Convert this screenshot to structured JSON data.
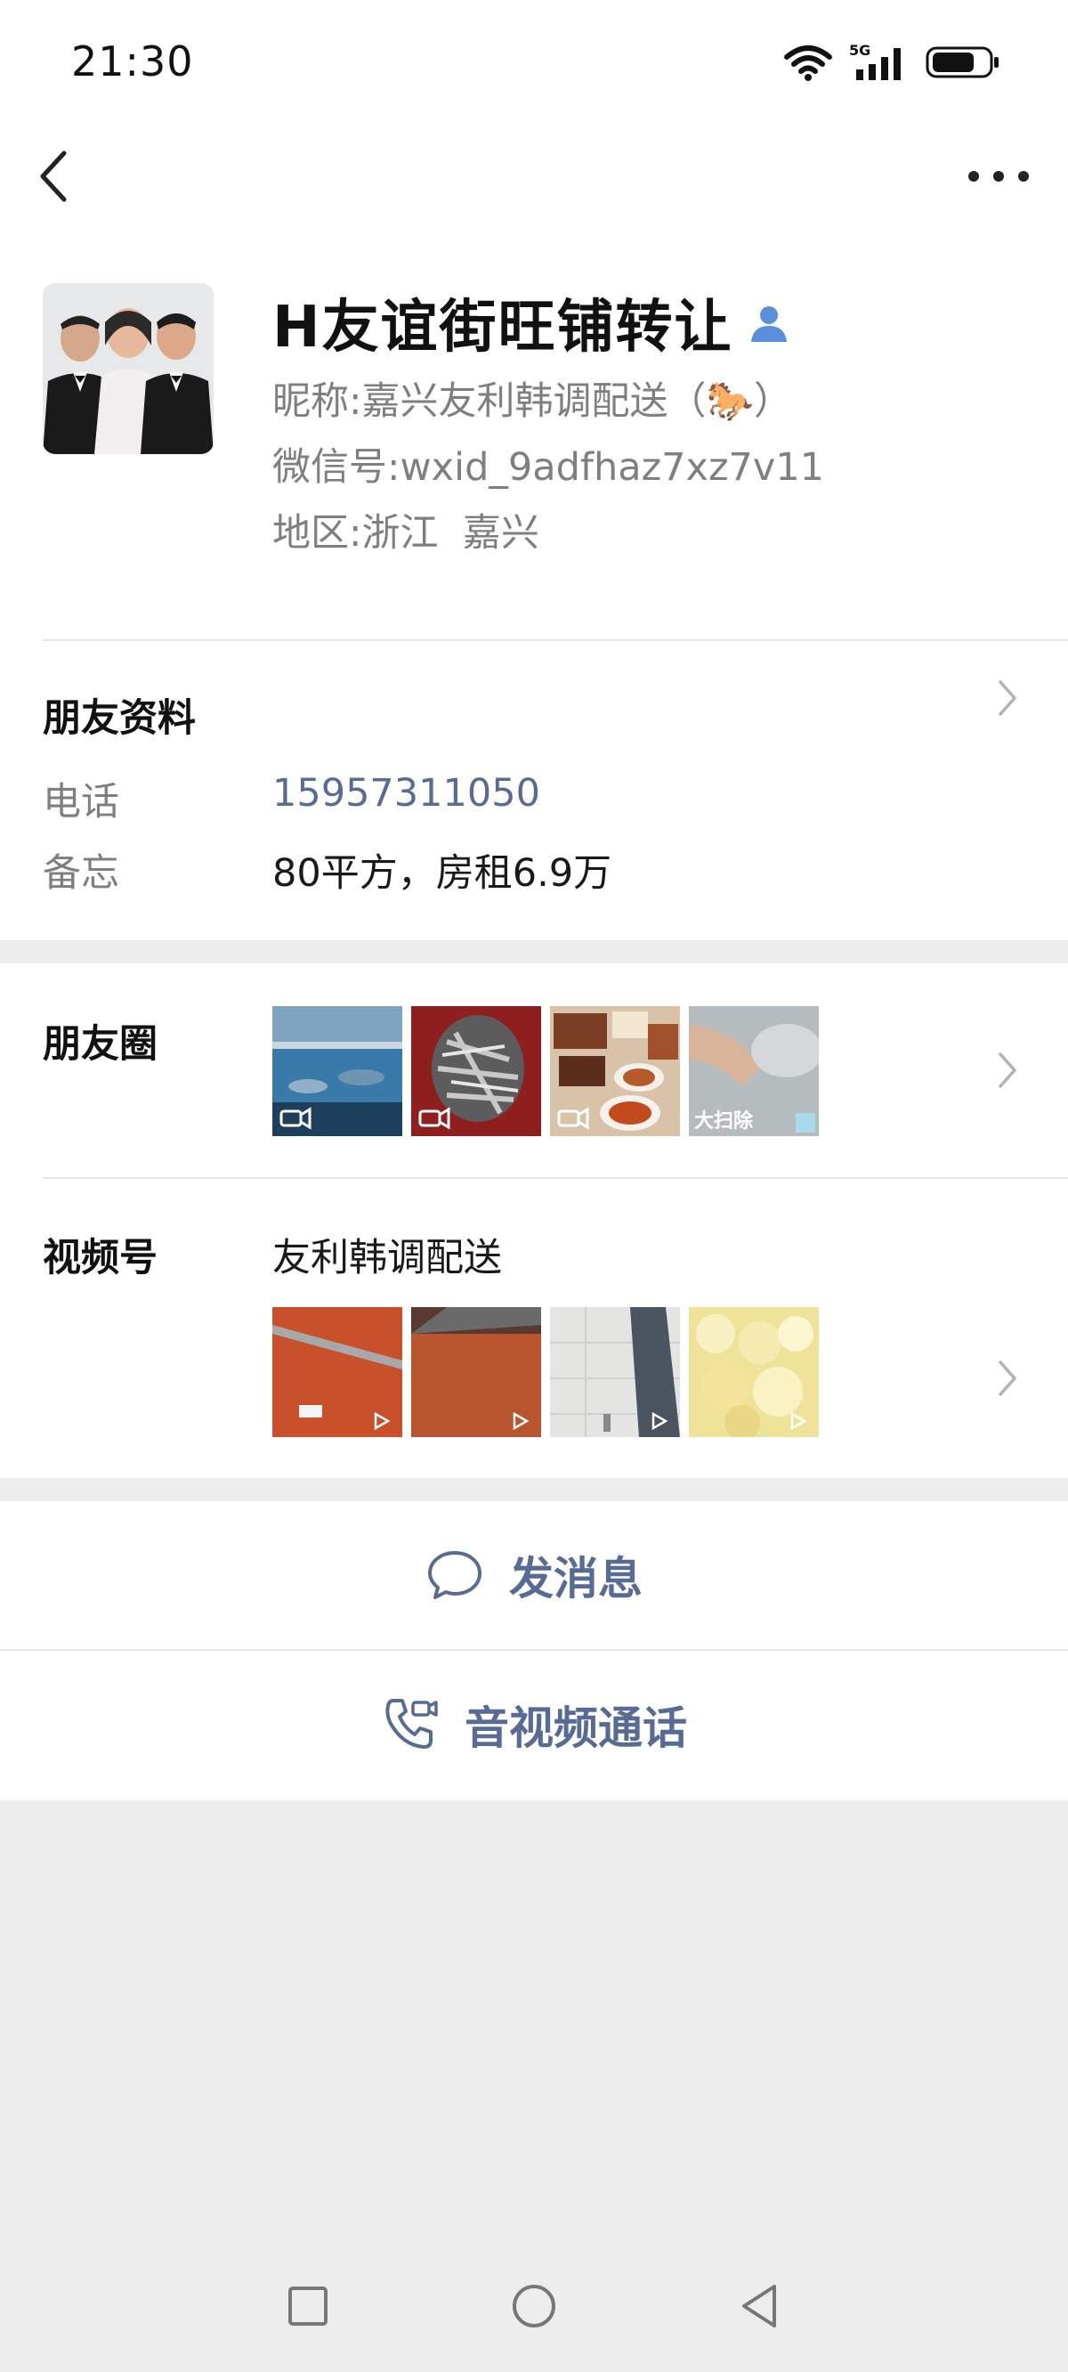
{
  "status_bar": {
    "time": "21:30",
    "network": "5G"
  },
  "profile": {
    "remark_name": "H友谊街旺铺转让",
    "nickname_label": "昵称:",
    "nickname": "嘉兴友利韩调配送（🐎）",
    "wechat_id_label": "微信号:",
    "wechat_id": "wxid_9adfhaz7xz7v11",
    "region_label": "地区:",
    "region": "浙江  嘉兴"
  },
  "friend_info": {
    "title": "朋友资料",
    "phone_label": "电话",
    "phone": "15957311050",
    "memo_label": "备忘",
    "memo": "80平方，房租6.9万"
  },
  "moments": {
    "title": "朋友圈",
    "thumb_overlay_text": "大扫除"
  },
  "channels": {
    "title": "视频号",
    "name": "友利韩调配送"
  },
  "actions": {
    "message": "发消息",
    "call": "音视频通话"
  },
  "colors": {
    "link": "#576b95",
    "background": "#ededed",
    "accent_blue": "#5a8fdc"
  }
}
